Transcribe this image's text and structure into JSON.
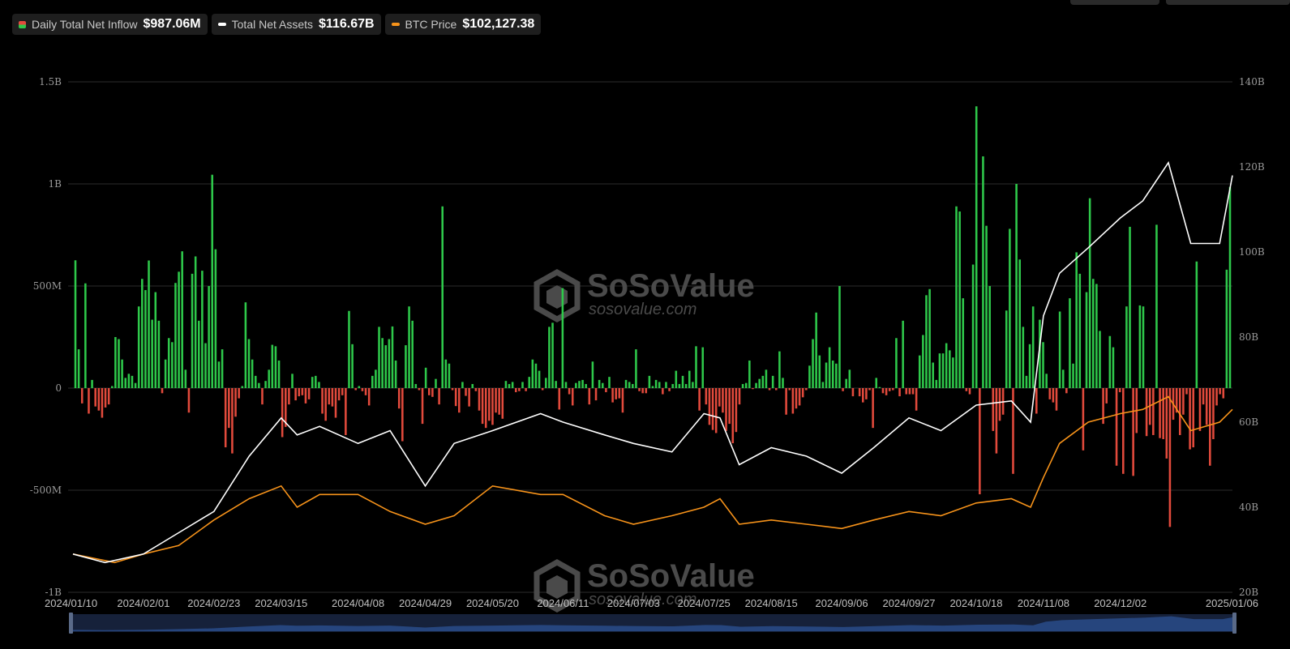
{
  "legend": [
    {
      "name": "Daily Total Net Inflow",
      "value": "$987.06M",
      "color": "#2ec84a"
    },
    {
      "name": "Total Net Assets",
      "value": "$116.67B",
      "color": "#ffffff"
    },
    {
      "name": "BTC Price",
      "value": "$102,127.38",
      "color": "#f7931a"
    }
  ],
  "watermark": {
    "brand": "SoSoValue",
    "url": "sosovalue.com"
  },
  "chart_data": {
    "type": "bar+line",
    "x_range": [
      "2024-01-10",
      "2025-01-06"
    ],
    "x_ticks": [
      "2024/01/10",
      "2024/02/01",
      "2024/02/23",
      "2024/03/15",
      "2024/04/08",
      "2024/04/29",
      "2024/05/20",
      "2024/06/11",
      "2024/07/03",
      "2024/07/25",
      "2024/08/15",
      "2024/09/06",
      "2024/09/27",
      "2024/10/18",
      "2024/11/08",
      "2024/12/02",
      "2025/01/06"
    ],
    "left_axis": {
      "ylim": [
        -1000,
        1500
      ],
      "unit": "M USD",
      "ticks": [
        {
          "v": 1500,
          "label": "1.5B"
        },
        {
          "v": 1000,
          "label": "1B"
        },
        {
          "v": 500,
          "label": "500M"
        },
        {
          "v": 0,
          "label": "0"
        },
        {
          "v": -500,
          "label": "-500M"
        },
        {
          "v": -1000,
          "label": "-1B"
        }
      ]
    },
    "right_axis": {
      "ylim": [
        20,
        140
      ],
      "unit": "B USD",
      "ticks": [
        "20B",
        "40B",
        "60B",
        "80B",
        "100B",
        "120B",
        "140B"
      ]
    },
    "colors": {
      "positive": "#2ec84a",
      "negative": "#e24a3c",
      "assets": "#ffffff",
      "price": "#f7931a",
      "grid": "#2c2c2c"
    },
    "grid": true,
    "inflow_series": {
      "name": "Daily Total Net Inflow",
      "unit": "M USD",
      "values": [
        626,
        190,
        -75,
        513,
        -125,
        40,
        -90,
        -110,
        -145,
        -95,
        -80,
        10,
        250,
        240,
        140,
        50,
        70,
        60,
        25,
        400,
        535,
        480,
        625,
        335,
        470,
        330,
        -25,
        140,
        245,
        225,
        515,
        570,
        670,
        90,
        -120,
        560,
        645,
        330,
        575,
        220,
        500,
        1045,
        680,
        130,
        190,
        -290,
        -195,
        -320,
        -140,
        -50,
        10,
        420,
        240,
        140,
        60,
        25,
        -80,
        35,
        90,
        212,
        205,
        135,
        -240,
        -190,
        -80,
        70,
        -60,
        -40,
        -35,
        -75,
        -55,
        55,
        60,
        30,
        -125,
        -160,
        -80,
        -90,
        -145,
        -60,
        -35,
        -230,
        378,
        215,
        -10,
        10,
        -15,
        -35,
        -85,
        60,
        90,
        300,
        245,
        210,
        240,
        302,
        135,
        -100,
        -260,
        210,
        400,
        330,
        20,
        -10,
        -175,
        100,
        -35,
        -43,
        45,
        -80,
        890,
        140,
        120,
        -10,
        -88,
        -120,
        30,
        -38,
        -90,
        20,
        -15,
        -110,
        -175,
        -195,
        -160,
        -180,
        -120,
        -130,
        -150,
        35,
        20,
        30,
        -20,
        -15,
        30,
        -15,
        55,
        140,
        120,
        85,
        -10,
        50,
        300,
        320,
        35,
        -105,
        490,
        30,
        -30,
        -85,
        25,
        35,
        40,
        20,
        -80,
        130,
        -60,
        40,
        25,
        -20,
        55,
        -70,
        -55,
        -50,
        -120,
        40,
        30,
        20,
        190,
        -15,
        -25,
        -25,
        60,
        10,
        40,
        30,
        -30,
        30,
        -15,
        20,
        85,
        20,
        60,
        20,
        85,
        30,
        205,
        -110,
        200,
        -80,
        -180,
        -205,
        -220,
        -90,
        -120,
        -210,
        -175,
        -270,
        -215,
        -80,
        20,
        25,
        135,
        -5,
        25,
        45,
        60,
        90,
        -10,
        60,
        -10,
        180,
        50,
        -130,
        -10,
        -125,
        -100,
        -85,
        -45,
        -10,
        110,
        240,
        370,
        160,
        30,
        125,
        200,
        135,
        120,
        500,
        -15,
        45,
        90,
        -40,
        0,
        -40,
        -70,
        -55,
        -10,
        -195,
        50,
        5,
        -25,
        -35,
        -15,
        -10,
        245,
        -40,
        330,
        -30,
        -30,
        -30,
        -110,
        160,
        260,
        455,
        485,
        125,
        40,
        170,
        170,
        220,
        185,
        150,
        890,
        865,
        440,
        -15,
        -30,
        605,
        1380,
        -520,
        1135,
        795,
        500,
        -210,
        -320,
        -160,
        -130,
        380,
        780,
        -420,
        1000,
        630,
        300,
        60,
        215,
        400,
        -125,
        335,
        225,
        70,
        -55,
        -70,
        -110,
        375,
        90,
        -25,
        440,
        120,
        665,
        560,
        -305,
        470,
        930,
        535,
        510,
        280,
        -175,
        -75,
        255,
        200,
        -380,
        -20,
        -420,
        400,
        790,
        -430,
        -220,
        405,
        400,
        -235,
        -180,
        -230,
        800,
        -245,
        -250,
        -345,
        -680,
        -155,
        -120,
        -230,
        -130,
        -30,
        -300,
        -290,
        620,
        -210,
        -80,
        -180,
        -380,
        -250,
        -85,
        -30,
        -50,
        580,
        985
      ]
    },
    "assets_series": {
      "name": "Total Net Assets",
      "unit": "B USD",
      "x": [
        "2024-01-10",
        "2024-01-20",
        "2024-02-01",
        "2024-02-12",
        "2024-02-23",
        "2024-03-05",
        "2024-03-15",
        "2024-03-20",
        "2024-03-27",
        "2024-04-08",
        "2024-04-18",
        "2024-04-29",
        "2024-05-08",
        "2024-05-20",
        "2024-06-04",
        "2024-06-11",
        "2024-06-24",
        "2024-07-03",
        "2024-07-15",
        "2024-07-25",
        "2024-07-30",
        "2024-08-05",
        "2024-08-15",
        "2024-08-26",
        "2024-09-06",
        "2024-09-16",
        "2024-09-27",
        "2024-10-07",
        "2024-10-18",
        "2024-10-29",
        "2024-11-04",
        "2024-11-08",
        "2024-11-13",
        "2024-11-22",
        "2024-12-02",
        "2024-12-09",
        "2024-12-17",
        "2024-12-24",
        "2025-01-02",
        "2025-01-06"
      ],
      "values": [
        29,
        27,
        29,
        34,
        39,
        52,
        61,
        57,
        59,
        55,
        58,
        45,
        55,
        58,
        62,
        60,
        57,
        55,
        53,
        62,
        61,
        50,
        54,
        52,
        48,
        54,
        61,
        58,
        64,
        65,
        60,
        85,
        95,
        101,
        108,
        112,
        121,
        102,
        102,
        118
      ]
    },
    "price_series": {
      "name": "BTC Price",
      "unit": "B (right axis)",
      "x": [
        "2024-01-10",
        "2024-01-23",
        "2024-02-01",
        "2024-02-12",
        "2024-02-23",
        "2024-03-05",
        "2024-03-15",
        "2024-03-20",
        "2024-03-27",
        "2024-04-08",
        "2024-04-18",
        "2024-04-29",
        "2024-05-08",
        "2024-05-20",
        "2024-06-04",
        "2024-06-11",
        "2024-06-24",
        "2024-07-03",
        "2024-07-15",
        "2024-07-25",
        "2024-07-30",
        "2024-08-05",
        "2024-08-15",
        "2024-08-26",
        "2024-09-06",
        "2024-09-16",
        "2024-09-27",
        "2024-10-07",
        "2024-10-18",
        "2024-10-29",
        "2024-11-04",
        "2024-11-08",
        "2024-11-13",
        "2024-11-22",
        "2024-12-02",
        "2024-12-09",
        "2024-12-17",
        "2024-12-24",
        "2025-01-02",
        "2025-01-06"
      ],
      "values": [
        29,
        27,
        29,
        31,
        37,
        42,
        45,
        40,
        43,
        43,
        39,
        36,
        38,
        45,
        43,
        43,
        38,
        36,
        38,
        40,
        42,
        36,
        37,
        36,
        35,
        37,
        39,
        38,
        41,
        42,
        40,
        47,
        55,
        60,
        62,
        63,
        66,
        58,
        60,
        63
      ]
    }
  }
}
